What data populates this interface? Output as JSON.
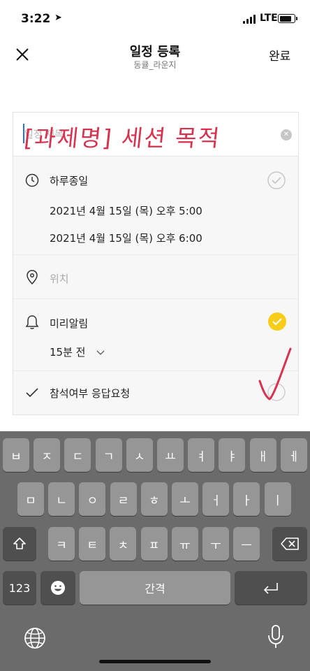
{
  "status_bar": {
    "time": "3:22",
    "network": "LTE",
    "location_icon": "location-arrow-icon"
  },
  "nav": {
    "title": "일정 등록",
    "subtitle": "동큘_라운지",
    "done_label": "완료",
    "close_icon": "close-icon"
  },
  "form": {
    "title_placeholder": "일정 제목",
    "handwriting": "[과제명] 세션 목적",
    "all_day_label": "하루종일",
    "start_datetime": "2021년 4월 15일 (목) 오후 5:00",
    "end_datetime": "2021년 4월 15일 (목) 오후 6:00",
    "location_placeholder": "위치",
    "reminder_label": "미리알림",
    "reminder_value": "15분 전",
    "rsvp_label": "참석여부 응답요청"
  },
  "keyboard": {
    "row1": [
      "ㅂ",
      "ㅈ",
      "ㄷ",
      "ㄱ",
      "ㅅ",
      "ㅛ",
      "ㅕ",
      "ㅑ",
      "ㅐ",
      "ㅔ"
    ],
    "row2": [
      "ㅁ",
      "ㄴ",
      "ㅇ",
      "ㄹ",
      "ㅎ",
      "ㅗ",
      "ㅓ",
      "ㅏ",
      "ㅣ"
    ],
    "row3": [
      "ㅋ",
      "ㅌ",
      "ㅊ",
      "ㅍ",
      "ㅠ",
      "ㅜ",
      "ㅡ"
    ],
    "num_key": "123",
    "space_label": "간격"
  },
  "colors": {
    "accent_yellow": "#f7cd1a",
    "handwriting_red": "#d8324f",
    "caret_blue": "#2f6fe4"
  }
}
